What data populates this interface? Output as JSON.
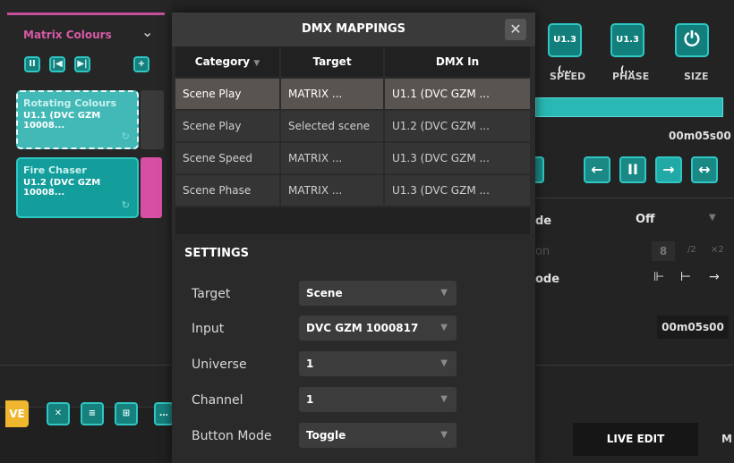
{
  "left_panel": {
    "header_title": "Matrix Colours",
    "cues": [
      {
        "name": "Rotating Colours",
        "device": "U1.1 (DVC GZM 10008..."
      },
      {
        "name": "Fire Chaser",
        "device": "U1.2 (DVC GZM 10008..."
      }
    ],
    "bottom_left_label": "VE"
  },
  "modal": {
    "title": "DMX MAPPINGS",
    "columns": [
      "Category",
      "Target",
      "DMX In"
    ],
    "rows": [
      {
        "category": "Scene Play",
        "target": "MATRIX ...",
        "dmx_in": "U1.1 (DVC GZM ..."
      },
      {
        "category": "Scene Play",
        "target": "Selected scene",
        "dmx_in": "U1.2 (DVC GZM ..."
      },
      {
        "category": "Scene Speed",
        "target": "MATRIX ...",
        "dmx_in": "U1.3 (DVC GZM ..."
      },
      {
        "category": "Scene Phase",
        "target": "MATRIX ...",
        "dmx_in": "U1.3 (DVC GZM ..."
      }
    ],
    "settings_title": "SETTINGS",
    "settings": [
      {
        "label": "Target",
        "value": "Scene"
      },
      {
        "label": "Input",
        "value": "DVC GZM 1000817"
      },
      {
        "label": "Universe",
        "value": "1"
      },
      {
        "label": "Channel",
        "value": "1"
      },
      {
        "label": "Button Mode",
        "value": "Toggle"
      }
    ]
  },
  "right_panel": {
    "knobs": [
      {
        "value": "U1.3 (...",
        "label": "SPEED"
      },
      {
        "value": "U1.3 (...",
        "label": "PHASE"
      },
      {
        "value": "",
        "label": "SIZE"
      }
    ],
    "time1": "00m05s00",
    "mode_label": "de",
    "mode_value": "Off",
    "on_label": "on",
    "on_value": "8",
    "div2": "/2",
    "mul2": "×2",
    "ode_label": "ode",
    "time2": "00m05s00",
    "live_edit": "LIVE EDIT",
    "tab_m": "M"
  }
}
